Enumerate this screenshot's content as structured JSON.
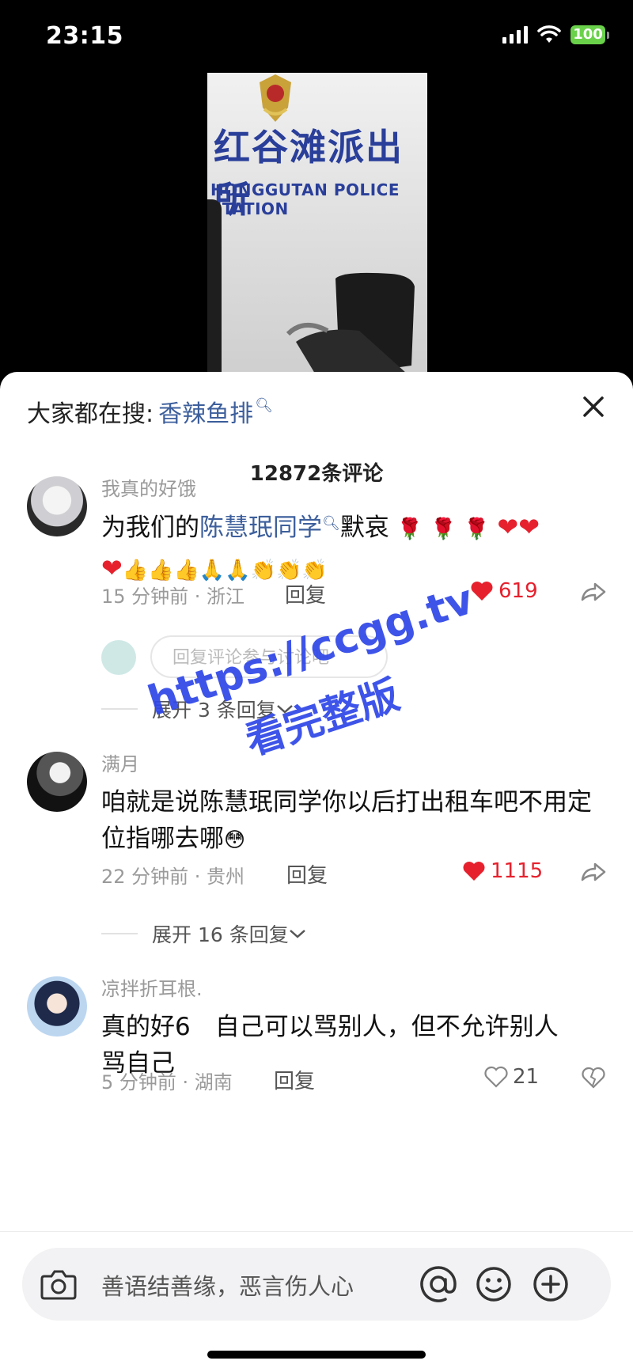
{
  "status_bar": {
    "time": "23:15",
    "battery": "100"
  },
  "video": {
    "sign_cn": "红谷滩派出所",
    "sign_en": "HONGGUTAN POLICE STATION"
  },
  "sheet": {
    "search_prefix": "大家都在搜:",
    "search_keyword": "香辣鱼排",
    "comment_count": "12872条评论"
  },
  "comments": [
    {
      "user": "我真的好饿",
      "text_pre": "为我们的",
      "text_link": "陈慧珉同学",
      "text_post": "默哀",
      "time_loc": "15 分钟前 · 浙江",
      "reply_label": "回复",
      "likes": "619",
      "liked": true,
      "reply_placeholder": "回复评论参与讨论吧"
    },
    {
      "user": "满月",
      "text": "咱就是说陈慧珉同学你以后打出租车吧不用定位指哪去哪",
      "time_loc": "22 分钟前 · 贵州",
      "reply_label": "回复",
      "likes": "1115",
      "liked": true,
      "expand_label": "展开 16 条回复"
    },
    {
      "user": "凉拌折耳根.",
      "text": "真的好6　自己可以骂别人，但不允许别人骂自己",
      "time_loc": "5 分钟前 · 湖南",
      "reply_label": "回复",
      "likes": "21",
      "liked": false
    }
  ],
  "expand_first": "展开 3 条回复",
  "watermark": {
    "line1": "https://ccgg.tv",
    "line2": "看完整版"
  },
  "composer": {
    "placeholder": "善语结善缘，恶言伤人心"
  },
  "colors": {
    "link": "#3d5f9c",
    "like_red": "#e6212d",
    "watermark": "#2e46e8"
  },
  "icons": [
    "signal-icon",
    "wifi-icon",
    "battery-icon",
    "search-icon",
    "close-icon",
    "heart-icon",
    "share-icon",
    "camera-icon",
    "at-icon",
    "emoji-icon",
    "plus-icon"
  ]
}
